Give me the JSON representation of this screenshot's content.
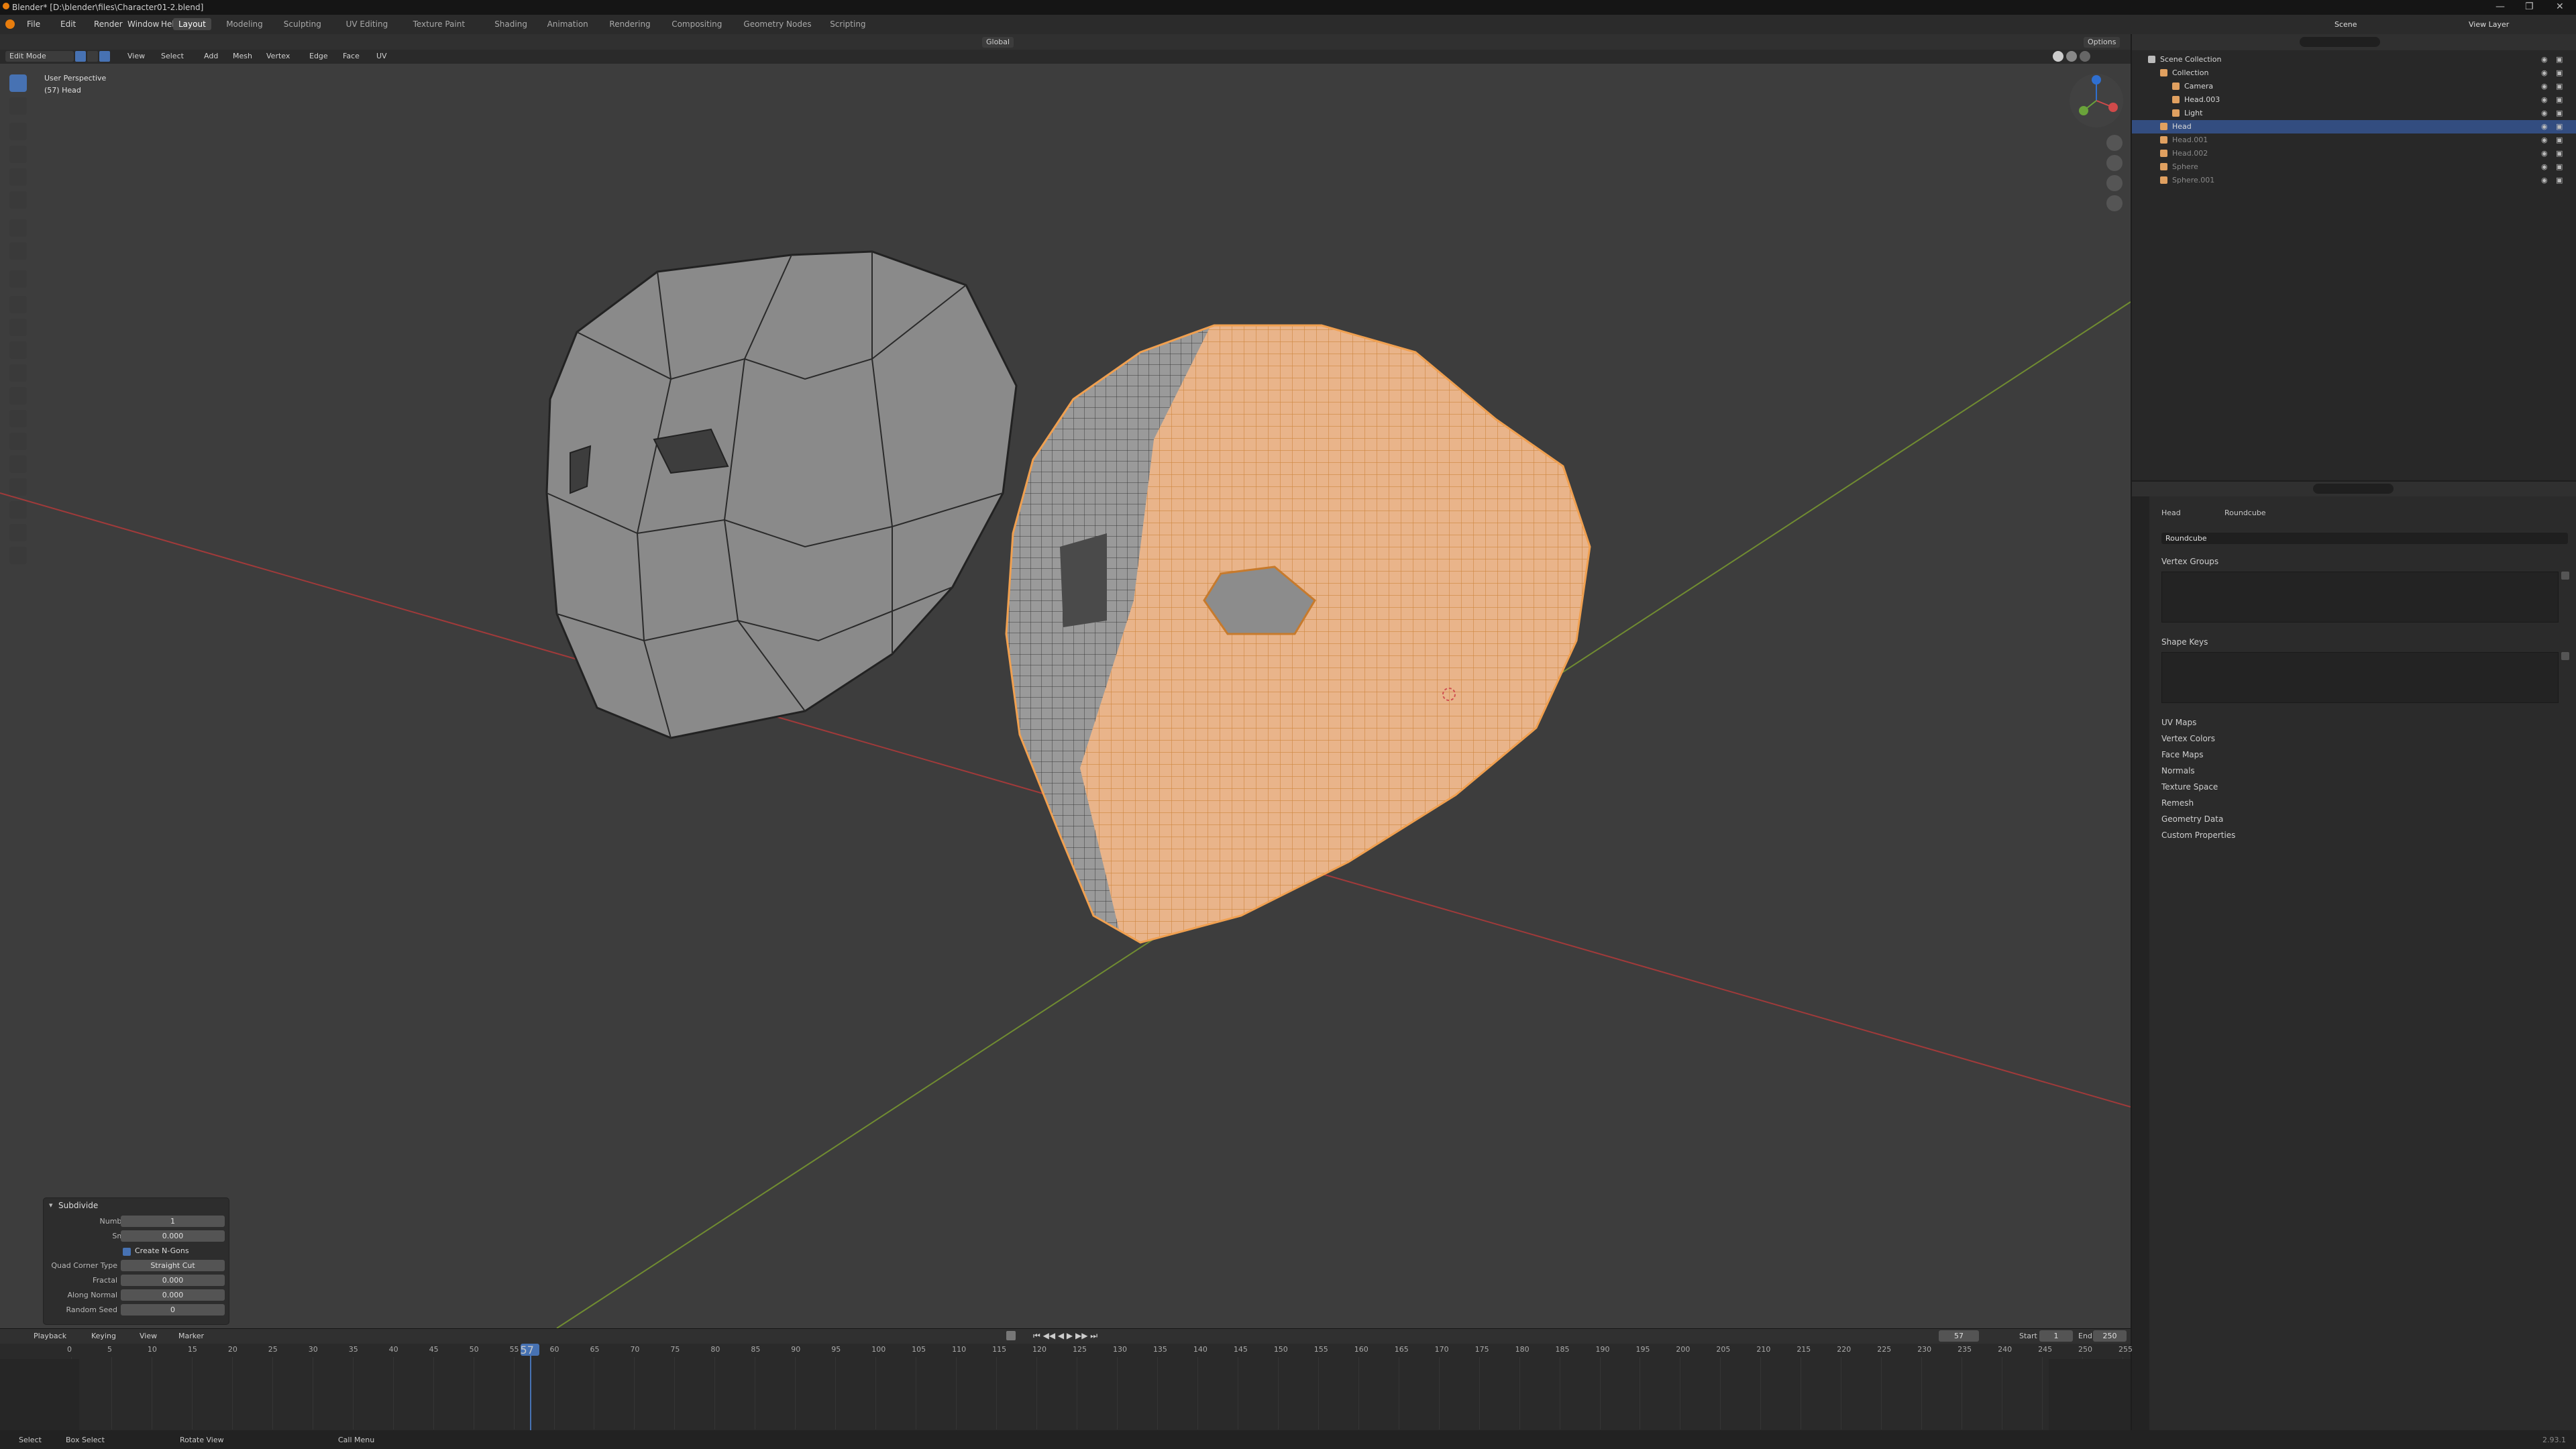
{
  "window": {
    "title": "Blender* [D:\\blender\\files\\Character01-2.blend]"
  },
  "menu": [
    "File",
    "Edit",
    "Render",
    "Window",
    "Help"
  ],
  "workspaces": [
    "Layout",
    "Modeling",
    "Sculpting",
    "UV Editing",
    "Texture Paint",
    "Shading",
    "Animation",
    "Rendering",
    "Compositing",
    "Geometry Nodes",
    "Scripting"
  ],
  "active_workspace": "Layout",
  "scene": {
    "scene_label": "Scene",
    "view_layer_label": "View Layer"
  },
  "viewport": {
    "mode": "Edit Mode",
    "menus": [
      "View",
      "Select",
      "Add",
      "Mesh",
      "Vertex",
      "Edge",
      "Face",
      "UV"
    ],
    "orientation": "Global",
    "options": "Options",
    "overlay_title": "User Perspective",
    "overlay_object": "(57) Head"
  },
  "operator_panel": {
    "title": "Subdivide",
    "fields": [
      {
        "label": "Number of Cuts",
        "value": "1"
      },
      {
        "label": "Smoothness",
        "value": "0.000"
      }
    ],
    "checkbox_label": "Create N-Gons",
    "checkbox_checked": true,
    "fields2": [
      {
        "label": "Quad Corner Type",
        "value": "Straight Cut"
      },
      {
        "label": "Fractal",
        "value": "0.000"
      },
      {
        "label": "Along Normal",
        "value": "0.000"
      },
      {
        "label": "Random Seed",
        "value": "0"
      }
    ]
  },
  "outliner": {
    "items": [
      {
        "name": "Scene Collection",
        "depth": 0,
        "selected": false
      },
      {
        "name": "Collection",
        "depth": 1,
        "selected": false
      },
      {
        "name": "Camera",
        "depth": 2,
        "selected": false
      },
      {
        "name": "Head.003",
        "depth": 2,
        "selected": false
      },
      {
        "name": "Light",
        "depth": 2,
        "selected": false
      },
      {
        "name": "Head",
        "depth": 1,
        "selected": true
      },
      {
        "name": "Head.001",
        "depth": 1,
        "selected": false
      },
      {
        "name": "Head.002",
        "depth": 1,
        "selected": false
      },
      {
        "name": "Sphere",
        "depth": 1,
        "selected": false
      },
      {
        "name": "Sphere.001",
        "depth": 1,
        "selected": false
      }
    ]
  },
  "properties": {
    "object_name": "Head",
    "mesh_name": "Roundcube",
    "mesh_field": "Roundcube",
    "panels": [
      "Vertex Groups",
      "Shape Keys"
    ],
    "collapsed": [
      "UV Maps",
      "Vertex Colors",
      "Face Maps",
      "Normals",
      "Texture Space",
      "Remesh",
      "Geometry Data",
      "Custom Properties"
    ]
  },
  "timeline": {
    "menus": [
      "Playback",
      "Keying",
      "View",
      "Marker"
    ],
    "current_frame": "57",
    "start_label": "Start",
    "start": "1",
    "end_label": "End",
    "end": "250",
    "ticks": [
      "0",
      "5",
      "10",
      "15",
      "20",
      "25",
      "30",
      "35",
      "40",
      "45",
      "50",
      "55",
      "60",
      "65",
      "70",
      "75",
      "80",
      "85",
      "90",
      "95",
      "100",
      "105",
      "110",
      "115",
      "120",
      "125",
      "130",
      "135",
      "140",
      "145",
      "150",
      "155",
      "160",
      "165",
      "170",
      "175",
      "180",
      "185",
      "190",
      "195",
      "200",
      "205",
      "210",
      "215",
      "220",
      "225",
      "230",
      "235",
      "240",
      "245",
      "250",
      "255"
    ]
  },
  "statusbar": {
    "select": "Select",
    "box_select": "Box Select",
    "rotate_view": "Rotate View",
    "call_menu": "Call Menu",
    "version": "2.93.1"
  },
  "colors": {
    "accent": "#4772b3",
    "selected_mesh": "#f0a050",
    "grid_x": "#b33a3a",
    "grid_y": "#7a9a30"
  }
}
